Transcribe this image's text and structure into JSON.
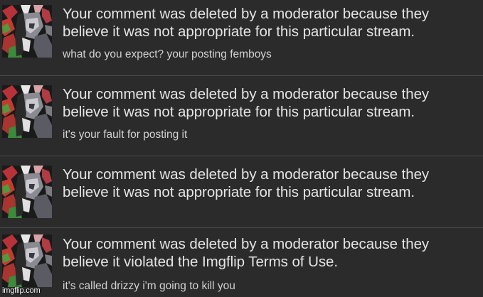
{
  "notifications": [
    {
      "message_line1": "Your comment was deleted by a moderator because they",
      "message_line2": "believe it was not appropriate for this particular stream.",
      "comment": "what do you expect? your posting femboys"
    },
    {
      "message_line1": "Your comment was deleted by a moderator because they",
      "message_line2": "believe it was not appropriate for this particular stream.",
      "comment": "it's your fault for posting it"
    },
    {
      "message_line1": "Your comment was deleted by a moderator because they",
      "message_line2": "believe it was not appropriate for this particular stream.",
      "comment": ""
    },
    {
      "message_line1": "Your comment was deleted by a moderator because they",
      "message_line2": "believe it violated the Imgflip Terms of Use.",
      "comment": "it's called drizzy i'm going to kill you"
    }
  ],
  "watermark": "imgflip.com",
  "colors": {
    "background": "#2b2b2b",
    "divider": "#4a4a4a",
    "text": "#e4e4e4"
  }
}
